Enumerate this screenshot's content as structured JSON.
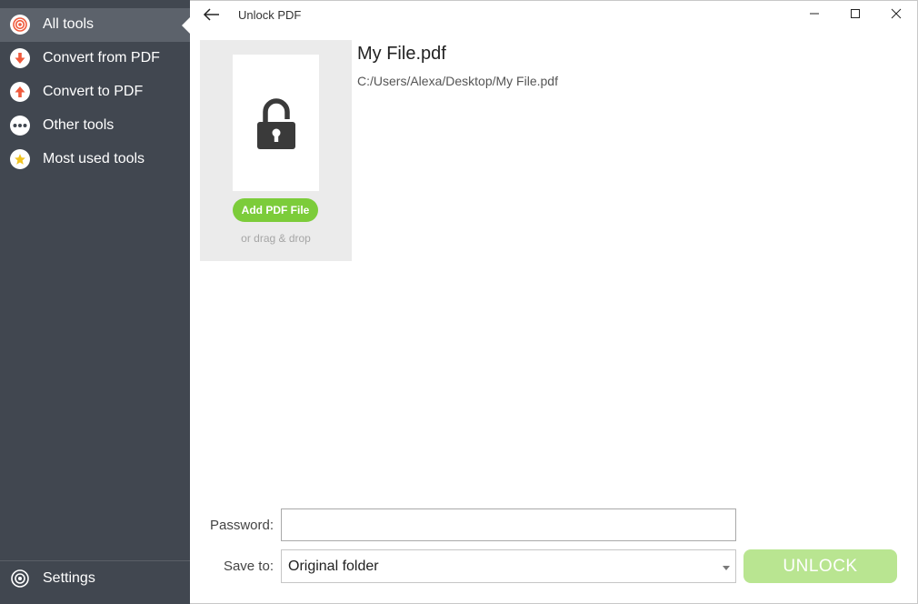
{
  "sidebar": {
    "items": [
      {
        "label": "All tools",
        "icon": "target-icon"
      },
      {
        "label": "Convert from PDF",
        "icon": "arrow-down-icon"
      },
      {
        "label": "Convert to PDF",
        "icon": "arrow-up-icon"
      },
      {
        "label": "Other tools",
        "icon": "ellipsis-icon"
      },
      {
        "label": "Most used tools",
        "icon": "star-icon"
      }
    ],
    "settings_label": "Settings"
  },
  "titlebar": {
    "title": "Unlock PDF"
  },
  "dropzone": {
    "add_button": "Add PDF File",
    "drag_text": "or drag & drop"
  },
  "file": {
    "name": "My File.pdf",
    "path": "C:/Users/Alexa/Desktop/My File.pdf"
  },
  "form": {
    "password_label": "Password:",
    "password_value": "",
    "save_label": "Save to:",
    "save_value": "Original folder",
    "unlock_button": "UNLOCK"
  },
  "colors": {
    "sidebar_bg": "#414750",
    "sidebar_active": "#5c626b",
    "accent_orange": "#f05a3c",
    "green_button": "#7ccc3a",
    "unlock_disabled": "#b9e591"
  }
}
